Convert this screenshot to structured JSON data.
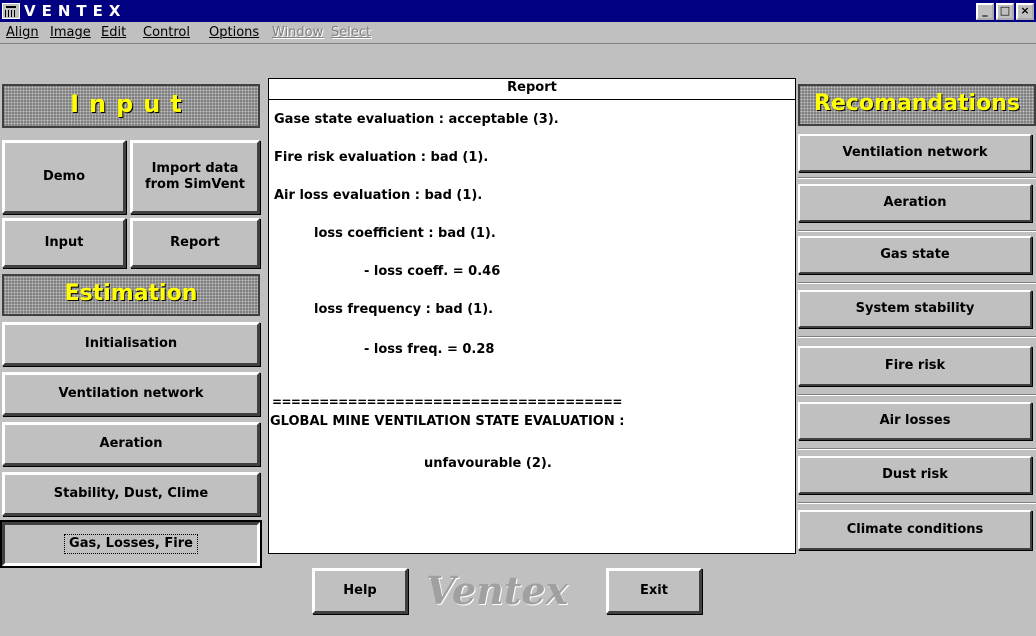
{
  "window": {
    "title": "VENTEX",
    "controls": [
      "_",
      "□",
      "×"
    ]
  },
  "menu": [
    "Align",
    "Image",
    "Edit",
    "Control",
    "Options",
    "Window",
    "Select"
  ],
  "left": {
    "input_header": "Input",
    "demo": "Demo",
    "import": "Import data from SimVent",
    "input": "Input",
    "report": "Report",
    "estimation_header": "Estimation",
    "initialisation": "Initialisation",
    "ventilation_network": "Ventilation network",
    "aeration": "Aeration",
    "stability": "Stability, Dust, Clime",
    "gas_losses_fire": "Gas, Losses, Fire"
  },
  "report": {
    "title": "Report",
    "lines": [
      "Gase state evaluation : acceptable (3).",
      "Fire risk evaluation : bad (1).",
      "Air loss evaluation : bad (1).",
      "loss coefficient : bad (1).",
      "- loss coeff.  =  0.46",
      "loss frequency : bad (1).",
      "- loss freq.  =  0.28",
      "=====================================",
      "GLOBAL MINE VENTILATION STATE EVALUATION :",
      "unfavourable (2)."
    ]
  },
  "right": {
    "header": "Recomandations",
    "buttons": [
      "Ventilation network",
      "Aeration",
      "Gas state",
      "System stability",
      "Fire risk",
      "Air losses",
      "Dust risk",
      "Climate conditions"
    ]
  },
  "bottom": {
    "help": "Help",
    "logo": "Ventex",
    "exit": "Exit"
  }
}
